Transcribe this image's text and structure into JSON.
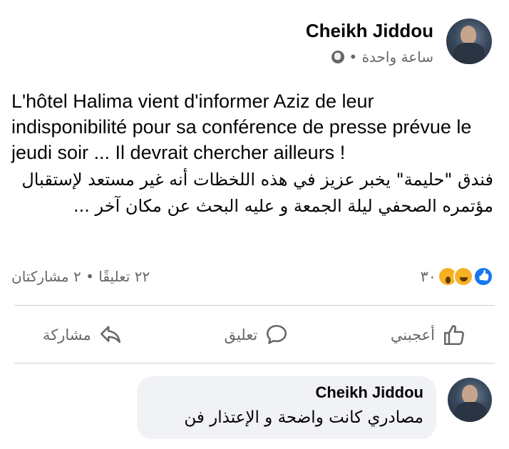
{
  "post": {
    "author": "Cheikh Jiddou",
    "time": "ساعة واحدة •",
    "privacy_icon": "globe-icon",
    "text_fr": "L'hôtel Halima vient d'informer Aziz de leur indisponibilité pour sa conférence de presse prévue le jeudi soir ... Il devrait chercher ailleurs !",
    "text_ar": "فندق \"حليمة\" يخبر عزيز في هذه اللخظات أنه غير مستعد لإستقبال مؤتمره الصحفي ليلة الجمعة و عليه البحث عن مكان آخر ..."
  },
  "stats": {
    "reaction_icons": [
      "like-icon",
      "haha-icon",
      "wow-icon"
    ],
    "reaction_count": "٣٠",
    "comments_shares": "٢٢ تعليقًا • ٢ مشاركتان"
  },
  "actions": {
    "like": "أعجبني",
    "comment": "تعليق",
    "share": "مشاركة"
  },
  "comment": {
    "author": "Cheikh Jiddou",
    "text": "مصادري كانت واضحة و الإعتذار فن"
  },
  "colors": {
    "text": "#050505",
    "secondary": "#65676b",
    "like_blue": "#1877f2",
    "bubble_bg": "#f0f2f5"
  }
}
